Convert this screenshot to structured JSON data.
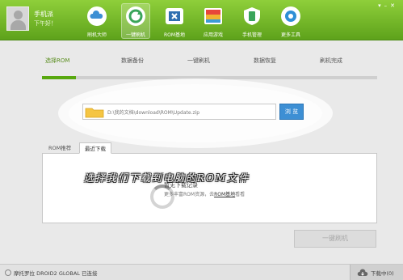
{
  "user": {
    "name": "手机派",
    "greeting": "下午好！"
  },
  "nav": [
    {
      "label": "刷机大师",
      "icon": "cloud-icon"
    },
    {
      "label": "一键刷机",
      "icon": "refresh-icon",
      "active": true
    },
    {
      "label": "ROM基地",
      "icon": "rom-icon"
    },
    {
      "label": "应用游戏",
      "icon": "apps-icon"
    },
    {
      "label": "手机管理",
      "icon": "shield-icon"
    },
    {
      "label": "更多工具",
      "icon": "tools-icon"
    }
  ],
  "steps": [
    "选择ROM",
    "数据备份",
    "一键刷机",
    "数据恢复",
    "刷机完成"
  ],
  "progress": 0.1,
  "file": {
    "path": "D:\\我的文档\\download\\ROM\\Update.zip",
    "browse_label": "浏 览"
  },
  "tabs": [
    {
      "label": "ROM推荐"
    },
    {
      "label": "最近下载",
      "active": true
    }
  ],
  "panel": {
    "title": "暂无下载记录",
    "desc_prefix": "更多丰富ROM资源，去",
    "desc_link": "ROM基地",
    "desc_suffix": "看看"
  },
  "flash_button_label": "一键刷机",
  "status": {
    "device": "摩托罗拉 DROID2 GLOBAL 已连接",
    "download_center": "下载中(0)"
  },
  "caption": "选择我们下载到电脑的ROM文件",
  "colors": {
    "header_green": "#6db52a",
    "accent_blue": "#3d8fd4",
    "progress_green": "#58a80f"
  }
}
